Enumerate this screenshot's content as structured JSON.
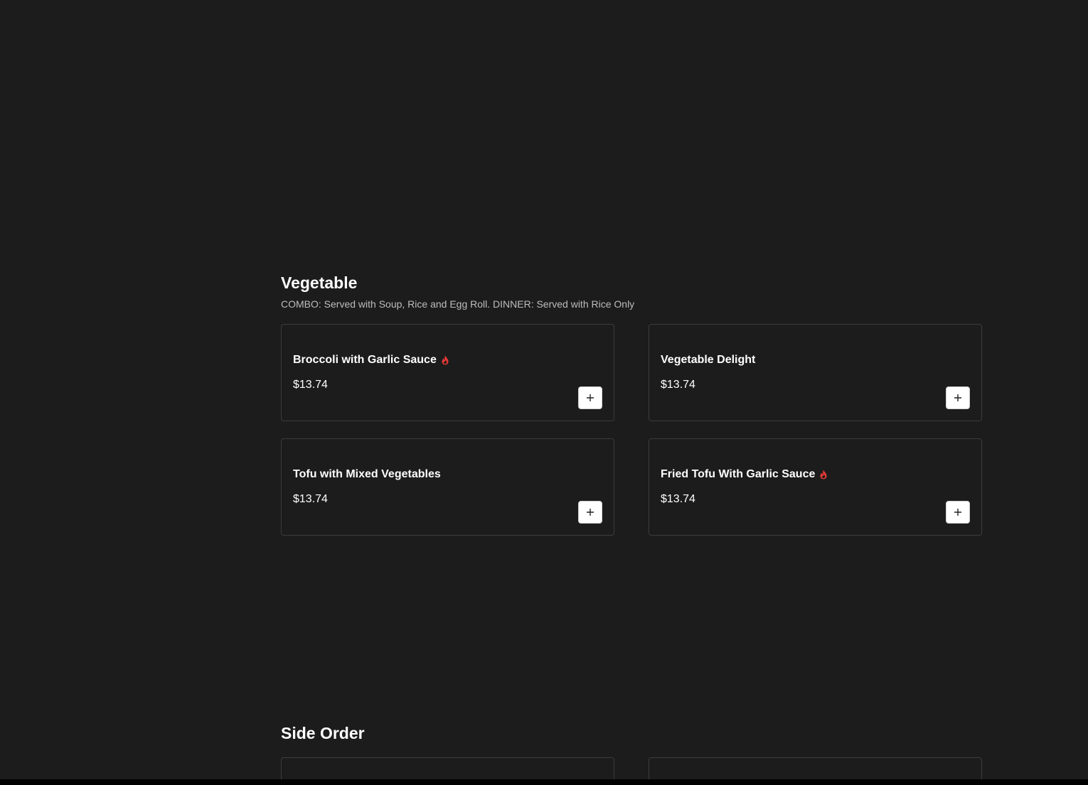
{
  "sections": [
    {
      "title": "Vegetable",
      "description": "COMBO: Served with Soup, Rice and Egg Roll. DINNER: Served with Rice Only",
      "items": [
        {
          "name": "Broccoli with Garlic Sauce",
          "price": "$13.74",
          "spicy": true
        },
        {
          "name": "Vegetable Delight",
          "price": "$13.74",
          "spicy": false
        },
        {
          "name": "Tofu with Mixed Vegetables",
          "price": "$13.74",
          "spicy": false
        },
        {
          "name": "Fried Tofu With Garlic Sauce",
          "price": "$13.74",
          "spicy": true
        }
      ]
    },
    {
      "title": "Side Order"
    }
  ],
  "icons": {
    "spicy": "flame-icon",
    "add": "plus-icon"
  },
  "colors": {
    "background": "#1c1c1c",
    "card_border": "#3c3c3c",
    "spicy": "#e53935",
    "button_bg": "#ffffff"
  }
}
